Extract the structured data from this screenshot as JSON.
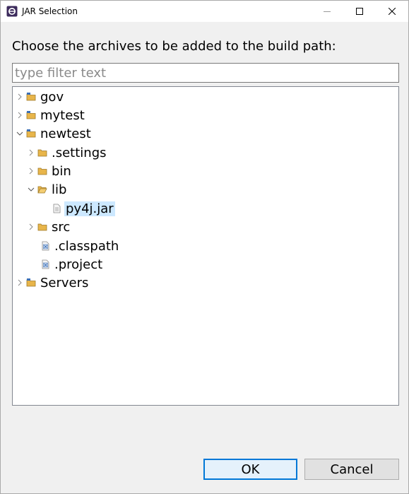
{
  "window": {
    "title": "JAR Selection"
  },
  "prompt": {
    "text": "Choose the archives to be added to the build path:"
  },
  "filter": {
    "placeholder": "type filter text",
    "value": ""
  },
  "tree": {
    "items": [
      {
        "label": "gov",
        "expanded": false,
        "icon": "project-folder-icon",
        "selected": false
      },
      {
        "label": "mytest",
        "expanded": false,
        "icon": "project-folder-icon",
        "selected": false
      },
      {
        "label": "newtest",
        "expanded": true,
        "icon": "project-folder-icon",
        "selected": false
      },
      {
        "label": ".settings",
        "expanded": false,
        "icon": "folder-icon",
        "selected": false
      },
      {
        "label": "bin",
        "expanded": false,
        "icon": "folder-icon",
        "selected": false
      },
      {
        "label": "lib",
        "expanded": true,
        "icon": "folder-icon",
        "selected": false
      },
      {
        "label": "py4j.jar",
        "icon": "jar-file-icon",
        "selected": true
      },
      {
        "label": "src",
        "expanded": false,
        "icon": "folder-icon",
        "selected": false
      },
      {
        "label": ".classpath",
        "icon": "xml-file-icon",
        "selected": false
      },
      {
        "label": ".project",
        "icon": "xml-file-icon",
        "selected": false
      },
      {
        "label": "Servers",
        "expanded": false,
        "icon": "project-folder-icon",
        "selected": false
      }
    ]
  },
  "buttons": {
    "ok": "OK",
    "cancel": "Cancel"
  },
  "colors": {
    "selection": "#cce8ff",
    "default_button_border": "#0078d7",
    "folder": "#e8b54a"
  }
}
